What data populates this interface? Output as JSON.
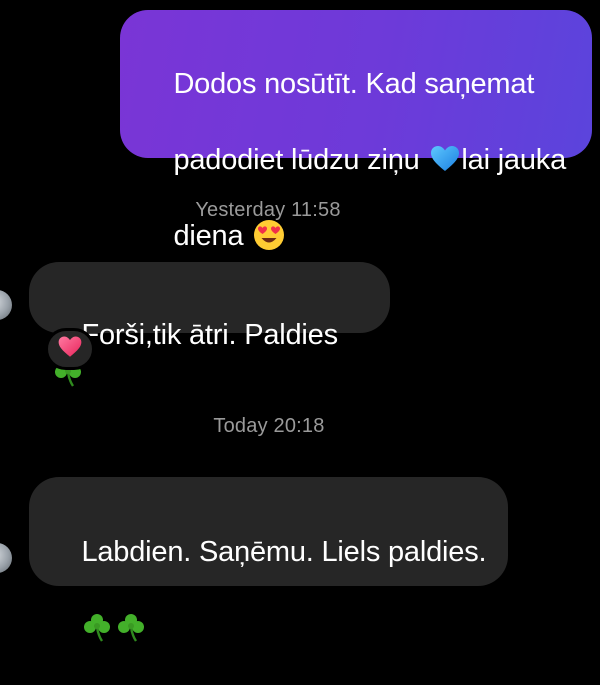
{
  "messages": [
    {
      "direction": "sent",
      "text_line1": "Dodos nosūtīt. Kad saņemat",
      "text_line2": "padodiet lūdzu ziņu ",
      "text_line2_after": "lai jauka",
      "text_line3": "diena ",
      "emojis": [
        "blue-heart",
        "heart-eyes-face"
      ]
    },
    {
      "direction": "received",
      "timestamp": "Yesterday 11:58",
      "text": "Forši,tik ātri. Paldies ",
      "emojis": [
        "shamrock"
      ],
      "reaction": "pink-heart"
    },
    {
      "direction": "received",
      "timestamp": "Today 20:18",
      "text_line1": "Labdien. Saņēmu. Liels paldies.",
      "emojis": [
        "shamrock",
        "shamrock"
      ]
    }
  ],
  "colors": {
    "background": "#000000",
    "sent_bubble": "#6d3ad9",
    "received_bubble": "#262626",
    "timestamp_text": "#9a9a9a"
  }
}
